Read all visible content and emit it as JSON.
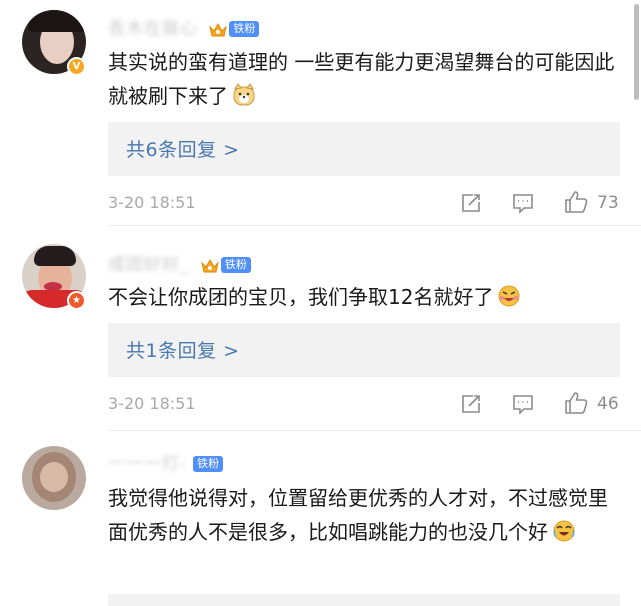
{
  "comments": [
    {
      "username": "吾木在我心",
      "fan_badge": "铁粉",
      "text": "其实说的蛮有道理的 一些更有能力更渴望舞台的可能因此就被刷下来了",
      "reply_label": "共6条回复 >",
      "timestamp": "3-20 18:51",
      "likes": "73",
      "badge_color": "#f5a623"
    },
    {
      "username": "成团好好_",
      "fan_badge": "铁粉",
      "text": "不会让你成团的宝贝，我们争取12名就好了",
      "reply_label": "共1条回复 >",
      "timestamp": "3-20 18:51",
      "likes": "46",
      "badge_color": "#f0592a"
    },
    {
      "username": "一一一打-",
      "fan_badge": "铁粉",
      "text": "我觉得他说得对，位置留给更优秀的人才对，不过感觉里面优秀的人不是很多，比如唱跳能力的也没几个好"
    }
  ],
  "icons": [
    "crown-icon",
    "share-icon",
    "comment-icon",
    "like-icon",
    "verified-icon",
    "emoji-icon"
  ],
  "colors": {
    "link": "#4a78b0",
    "fan_badge": "#4f8ff7",
    "meta": "#a8a8a8"
  }
}
